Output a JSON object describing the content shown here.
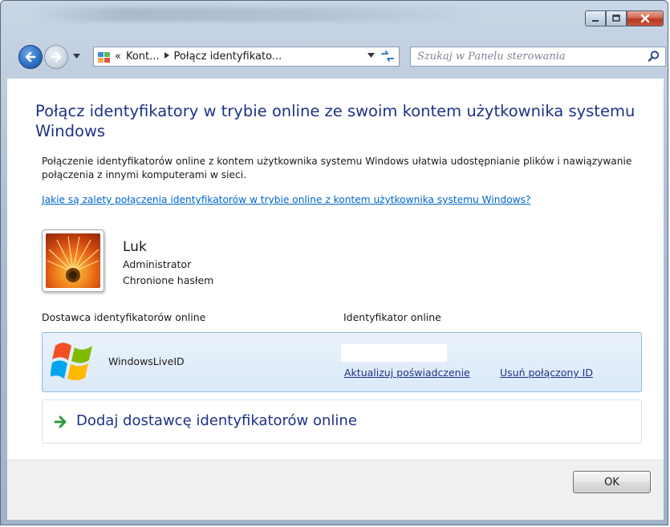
{
  "window": {
    "controls": {
      "minimize": "",
      "maximize": "",
      "close": ""
    }
  },
  "navigation": {
    "address": {
      "overflow": "«",
      "segments": [
        "Kont...",
        "Połącz identyfikato..."
      ]
    },
    "search": {
      "placeholder": "Szukaj w Panelu sterowania"
    },
    "icons": [
      "back-arrow-icon",
      "forward-arrow-icon",
      "control-panel-icon",
      "refresh-icon",
      "search-icon"
    ]
  },
  "main": {
    "heading": "Połącz identyfikatory w trybie online ze swoim kontem użytkownika systemu Windows",
    "description": "Połączenie identyfikatorów online z kontem użytkownika systemu Windows ułatwia udostępnianie plików i nawiązywanie połączenia z innymi komputerami w sieci.",
    "help_link": "Jakie są zalety połączenia identyfikatorów w trybie online z kontem użytkownika systemu Windows?",
    "user": {
      "name": "Luk",
      "role": "Administrator",
      "status": "Chronione hasłem"
    },
    "table": {
      "col_provider": "Dostawca identyfikatorów online",
      "col_id": "Identyfikator online"
    },
    "provider": {
      "name": "WindowsLiveID",
      "id_value": "",
      "update_link": "Aktualizuj poświadczenie",
      "remove_link": "Usuń połączony ID"
    },
    "add_provider": "Dodaj dostawcę identyfikatorów online"
  },
  "footer": {
    "ok_label": "OK"
  },
  "colors": {
    "heading": "#1e3287",
    "link": "#0066cc",
    "row_bg": "#dbe9f8",
    "row_border": "#93b8dd",
    "add_arrow": "#2e9a3a"
  }
}
